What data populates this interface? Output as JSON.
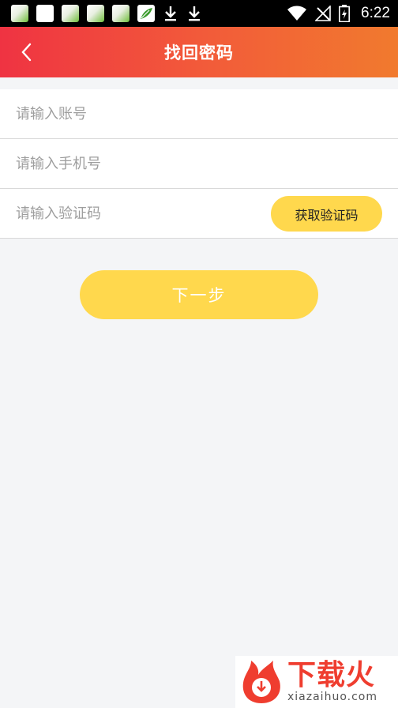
{
  "status_bar": {
    "time": "6:22",
    "notification_icons": [
      "app-icon",
      "app-icon-white",
      "app-icon",
      "app-icon",
      "app-icon",
      "leaf-app-icon",
      "download-icon",
      "download-icon"
    ],
    "system_icons": [
      "wifi-icon",
      "no-signal-icon",
      "battery-charging-icon"
    ]
  },
  "header": {
    "title": "找回密码",
    "back_icon": "chevron-left-icon",
    "gradient": [
      "#ef3342",
      "#f17a2e"
    ]
  },
  "form": {
    "account": {
      "value": "",
      "placeholder": "请输入账号"
    },
    "phone": {
      "value": "",
      "placeholder": "请输入手机号"
    },
    "code": {
      "value": "",
      "placeholder": "请输入验证码"
    },
    "get_code_label": "获取验证码"
  },
  "next_label": "下一步",
  "colors": {
    "accent_yellow": "#ffd84d",
    "background": "#f4f5f7"
  },
  "watermark": {
    "text_cn": "下载火",
    "text_en": "xiazaihuo.com"
  }
}
